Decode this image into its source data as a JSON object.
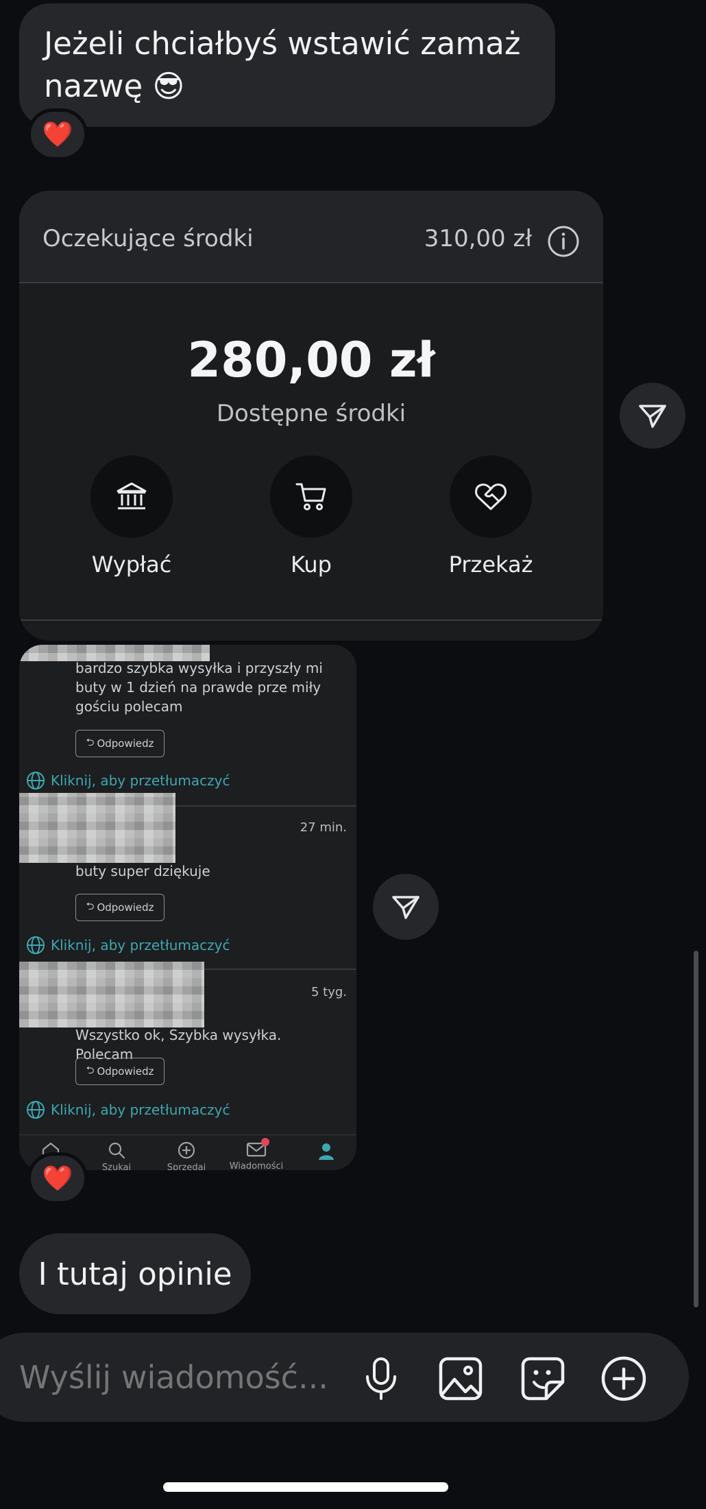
{
  "messages": {
    "first": "Jeżeli chciałbyś wstawić zamaż nazwę 😎",
    "first_reaction": "❤️",
    "last": "I tutaj opinie",
    "second_reaction": "❤️"
  },
  "wallet": {
    "pending_label": "Oczekujące środki",
    "pending_amount": "310,00 zł",
    "balance": "280,00 zł",
    "balance_label": "Dostępne środki",
    "actions": [
      {
        "label": "Wypłać",
        "icon": "bank-icon"
      },
      {
        "label": "Kup",
        "icon": "cart-icon"
      },
      {
        "label": "Przekaż",
        "icon": "heart-handshake-icon"
      }
    ]
  },
  "reviews": {
    "items": [
      {
        "text": "bardzo szybka wysyłka i przyszły mi buty w 1 dzień na prawde prze miły gościu polecam",
        "time": ""
      },
      {
        "text": "buty super dziękuje",
        "time": "27 min."
      },
      {
        "text": "Wszystko ok, Szybka wysyłka. Polecam",
        "time": "5 tyg."
      }
    ],
    "reply_label": "Odpowiedz",
    "translate_label": "Kliknij, aby przetłumaczyć",
    "tabs": [
      "",
      "Szukaj",
      "Sprzedaj",
      "Wiadomości",
      ""
    ],
    "accent_color": "#3fa7b0",
    "notification_color": "#e0455a"
  },
  "composer": {
    "placeholder": "Wyślij wiadomość..."
  }
}
